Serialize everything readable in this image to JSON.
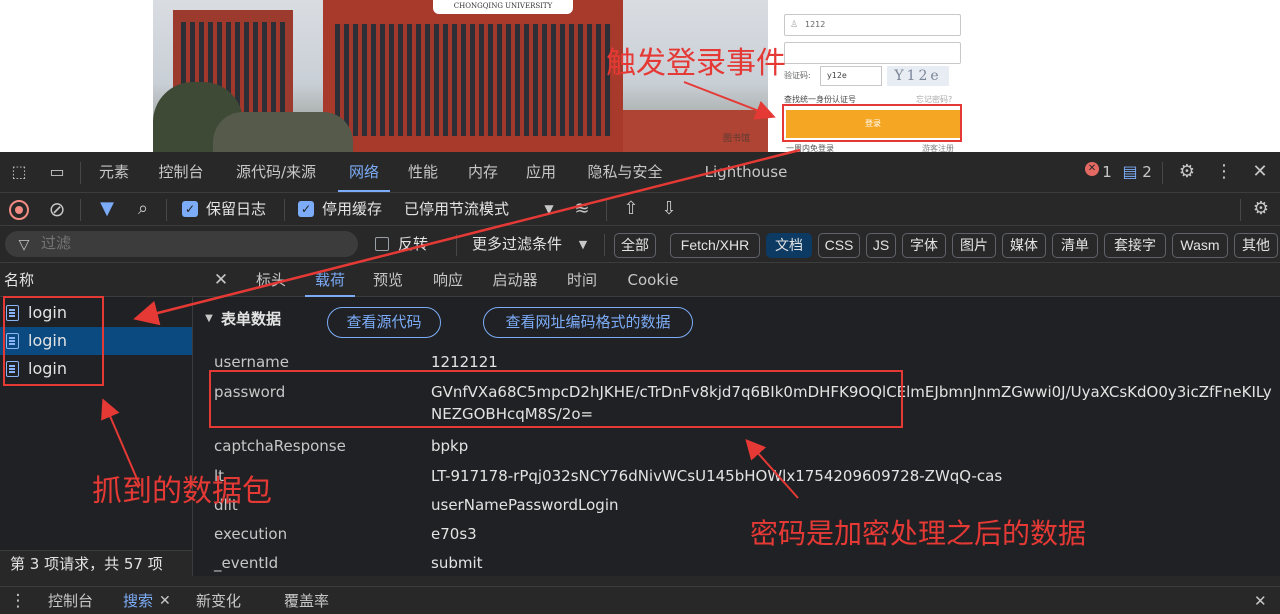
{
  "webpage": {
    "username_value": "1212",
    "captcha_label": "验证码:",
    "captcha_value": "y12e",
    "captcha_image_text": "Y12e",
    "find_link": "查找统一身份认证号",
    "forgot_link": "忘记密码?",
    "login_button": "登录",
    "bottom_link_left": "一周内免登录",
    "bottom_link_right": "游客注册",
    "campus_sign": "CHONGQING UNIVERSITY",
    "campus_caption": "图书馆"
  },
  "devtools": {
    "main_tabs": [
      "元素",
      "控制台",
      "源代码/来源",
      "网络",
      "性能",
      "内存",
      "应用",
      "隐私与安全",
      "Lighthouse"
    ],
    "active_main_tab": "网络",
    "error_count": "1",
    "message_count": "2",
    "toolbar": {
      "preserve_log": "保留日志",
      "disable_cache": "停用缓存",
      "throttle": "已停用节流模式"
    },
    "filter": {
      "placeholder": "过滤",
      "invert": "反转",
      "more_filters": "更多过滤条件",
      "types": [
        "全部",
        "Fetch/XHR",
        "文档",
        "CSS",
        "JS",
        "字体",
        "图片",
        "媒体",
        "清单",
        "套接字",
        "Wasm",
        "其他"
      ],
      "selected_type": "文档"
    },
    "requests": {
      "header": "名称",
      "items": [
        "login",
        "login",
        "login"
      ],
      "selected_index": 1,
      "status": "第 3 项请求，共 57 项"
    },
    "detail": {
      "tabs": [
        "标头",
        "载荷",
        "预览",
        "响应",
        "启动器",
        "时间",
        "Cookie"
      ],
      "active_tab": "载荷",
      "section_title": "表单数据",
      "view_source": "查看源代码",
      "view_url_encoded": "查看网址编码格式的数据",
      "fields": [
        {
          "key": "username",
          "value": "1212121"
        },
        {
          "key": "password",
          "value": "GVnfVXa68C5mpcD2hJKHE/cTrDnFv8kjd7q6BIk0mDHFK9OQlCElmEJbmnJnmZGwwi0J/UyaXCsKdO0y3icZfFneKILyNEZGOBHcqM8S/2o="
        },
        {
          "key": "captchaResponse",
          "value": "bpkp"
        },
        {
          "key": "lt",
          "value": "LT-917178-rPqj032sNCY76dNivWCsU145bHOWlx1754209609728-ZWqQ-cas"
        },
        {
          "key": "dllt",
          "value": "userNamePasswordLogin"
        },
        {
          "key": "execution",
          "value": "e70s3"
        },
        {
          "key": "_eventId",
          "value": "submit"
        }
      ]
    },
    "drawer_tabs": [
      "控制台",
      "搜索",
      "新变化",
      "覆盖率"
    ],
    "active_drawer_tab": "搜索"
  },
  "annotations": {
    "trigger_login": "触发登录事件",
    "captured_packets": "抓到的数据包",
    "encrypted_password": "密码是加密处理之后的数据"
  },
  "colors": {
    "accent": "#7cacf8",
    "annotation_red": "#e53935",
    "login_orange": "#f5a623",
    "selected_row": "#0b4a80"
  }
}
